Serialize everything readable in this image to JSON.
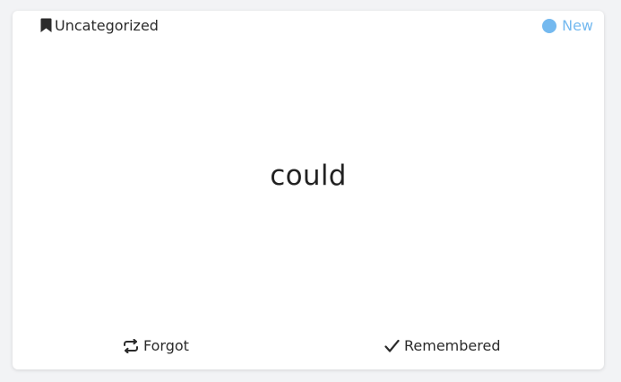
{
  "card": {
    "category": {
      "label": "Uncategorized",
      "icon": "bookmark-icon"
    },
    "status": {
      "label": "New",
      "color": "#74b9ef",
      "icon": "status-dot-icon"
    },
    "word": "could"
  },
  "actions": {
    "forgot": {
      "label": "Forgot",
      "icon": "repeat-icon"
    },
    "remembered": {
      "label": "Remembered",
      "icon": "checkmark-icon"
    }
  },
  "colors": {
    "background": "#f2f3f5",
    "card": "#ffffff",
    "text": "#2b2b2b",
    "status": "#74b9ef"
  }
}
